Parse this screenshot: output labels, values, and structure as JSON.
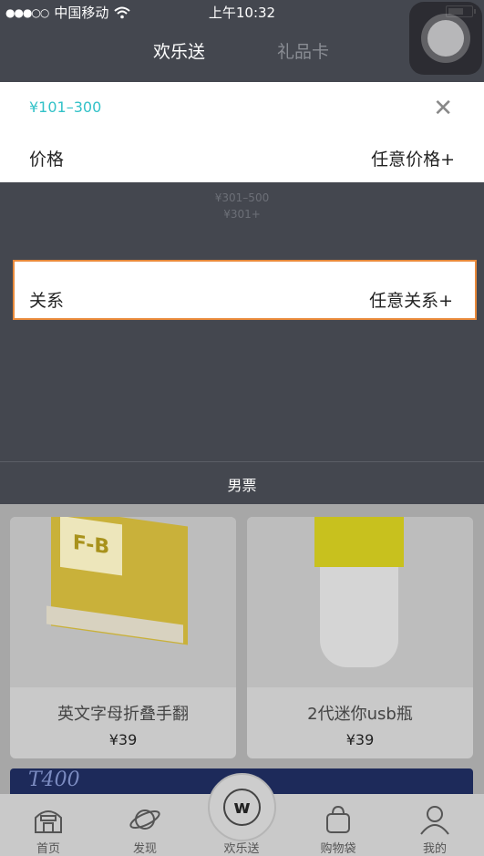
{
  "status_bar": {
    "carrier": "中国移动",
    "signal": "●●●○○",
    "time": "上午10:32"
  },
  "nav": {
    "tabs": [
      {
        "label": "欢乐送",
        "active": true
      },
      {
        "label": "礼品卡",
        "active": false
      }
    ]
  },
  "price_filter": {
    "selected_range": "¥101–300",
    "label": "价格",
    "value": "任意价格+"
  },
  "background_options": [
    "¥301–500",
    "¥301+"
  ],
  "relation_filter": {
    "label": "关系",
    "value": "任意关系+"
  },
  "gender_option": "男票",
  "products": [
    {
      "title": "英文字母折叠手翻",
      "price": "¥39",
      "image_text": "F-B"
    },
    {
      "title": "2代迷你usb瓶",
      "price": "¥39"
    }
  ],
  "banner_text": "T400",
  "tabbar": {
    "items": [
      {
        "label": "首页",
        "icon": "home-icon"
      },
      {
        "label": "发现",
        "icon": "planet-icon"
      },
      {
        "label": "欢乐送",
        "icon": "w-logo-icon"
      },
      {
        "label": "购物袋",
        "icon": "bag-icon"
      },
      {
        "label": "我的",
        "icon": "user-icon"
      }
    ],
    "center_glyph": "w"
  },
  "colors": {
    "accent": "#33c2c8",
    "highlight_border": "#e8893a",
    "overlay": "#44474f"
  }
}
